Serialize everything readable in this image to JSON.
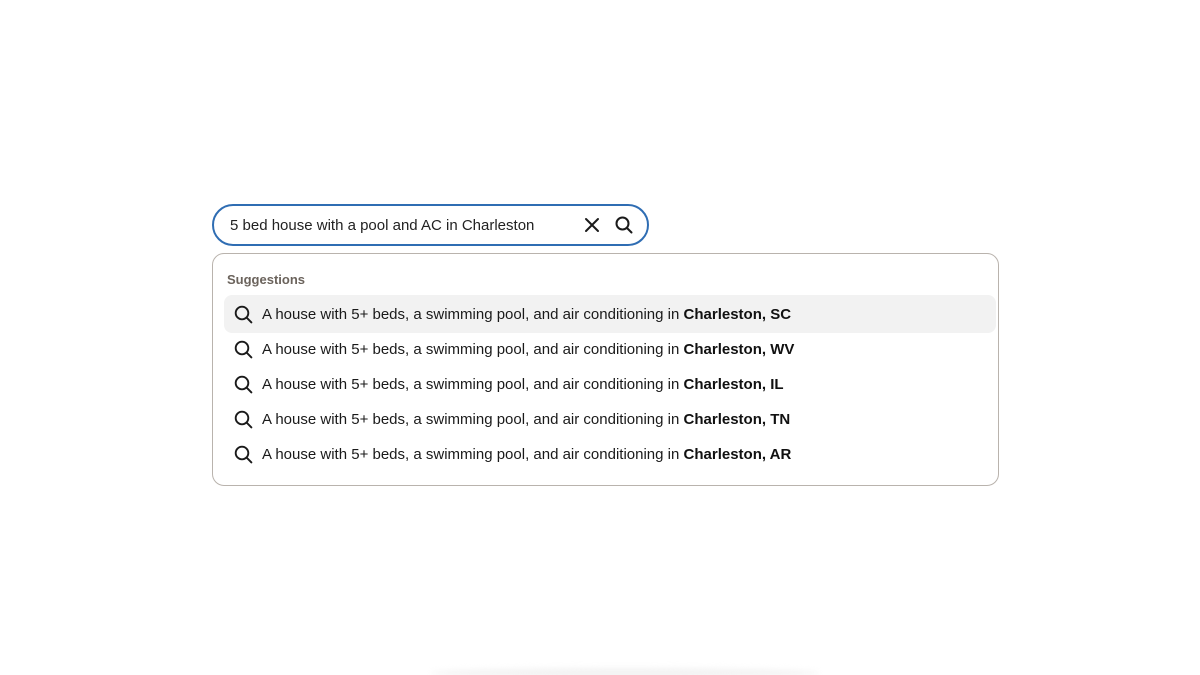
{
  "search": {
    "value": "5 bed house with a pool and AC in Charleston",
    "clear_icon": "close-icon",
    "search_icon": "search-icon"
  },
  "dropdown": {
    "heading": "Suggestions",
    "items": [
      {
        "prefix": "A house with 5+ beds, a swimming pool, and air conditioning in ",
        "location": "Charleston, SC",
        "highlighted": true
      },
      {
        "prefix": "A house with 5+ beds, a swimming pool, and air conditioning in ",
        "location": "Charleston, WV",
        "highlighted": false
      },
      {
        "prefix": "A house with 5+ beds, a swimming pool, and air conditioning in ",
        "location": "Charleston, IL",
        "highlighted": false
      },
      {
        "prefix": "A house with 5+ beds, a swimming pool, and air conditioning in ",
        "location": "Charleston, TN",
        "highlighted": false
      },
      {
        "prefix": "A house with 5+ beds, a swimming pool, and air conditioning in ",
        "location": "Charleston, AR",
        "highlighted": false
      }
    ]
  },
  "colors": {
    "focus_border": "#2f6db3",
    "dropdown_border": "#b9b3ad",
    "heading_text": "#6b635c",
    "highlight_bg": "#f2f2f2"
  }
}
